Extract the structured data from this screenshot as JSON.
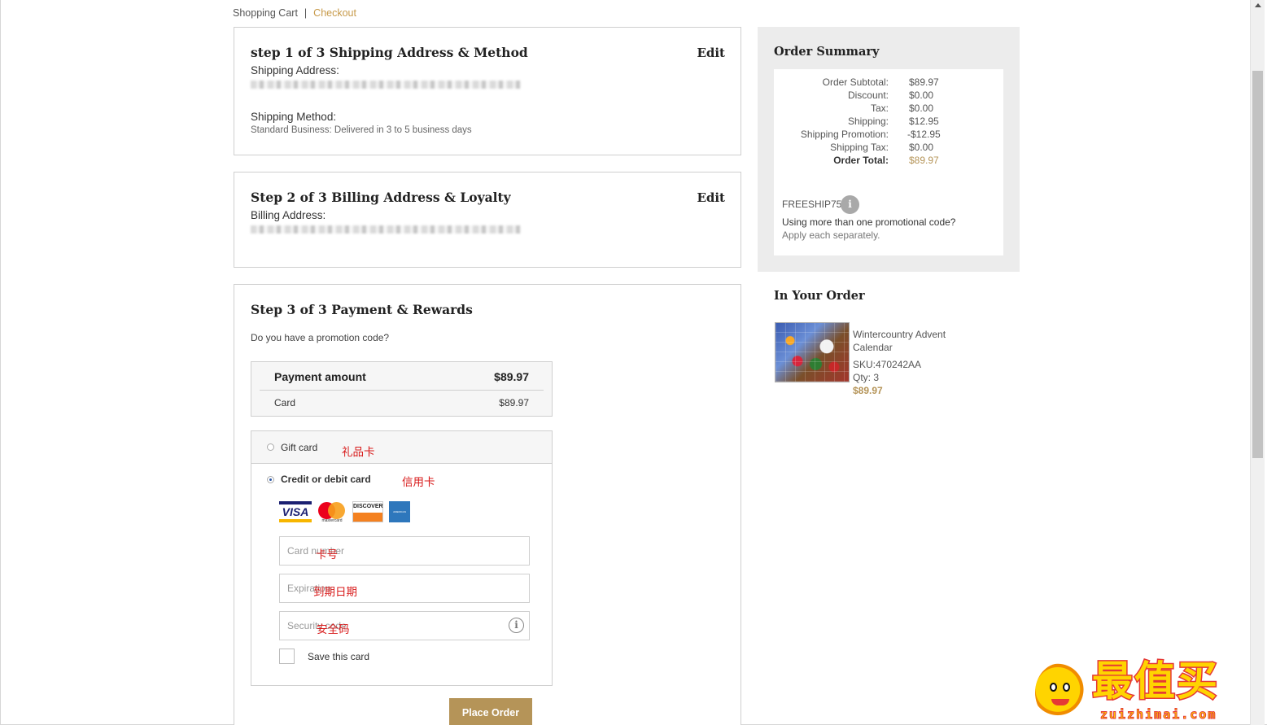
{
  "breadcrumb": {
    "cart": "Shopping Cart",
    "separator": "|",
    "checkout": "Checkout"
  },
  "step1": {
    "title": "step 1 of 3 Shipping Address & Method",
    "edit": "Edit",
    "address_label": "Shipping Address:",
    "method_label": "Shipping Method:",
    "method_value": "Standard Business: Delivered in 3 to 5 business days"
  },
  "step2": {
    "title": "Step 2 of 3 Billing Address & Loyalty",
    "edit": "Edit",
    "address_label": "Billing Address:"
  },
  "step3": {
    "title": "Step 3 of 3 Payment & Rewards",
    "promo_question": "Do you have a promotion code?",
    "payment_amount_label": "Payment amount",
    "payment_amount_value": "$89.97",
    "card_label": "Card",
    "card_value": "$89.97",
    "gift_card_label": "Gift card",
    "gift_card_note": "礼品卡",
    "credit_label": "Credit or debit card",
    "credit_note": "信用卡",
    "card_brands": [
      "VISA",
      "mastercard",
      "DISCOVER",
      "AMERICAN EXPRESS"
    ],
    "card_number_placeholder": "Card number",
    "card_number_note": "卡号",
    "expiration_placeholder": "Expiration",
    "expiration_note": "到期日期",
    "security_placeholder": "Security code",
    "security_note": "安全码",
    "save_card_label": "Save this card",
    "place_order": "Place Order",
    "selected_method": "credit"
  },
  "summary": {
    "title": "Order Summary",
    "rows": [
      {
        "label": "Order Subtotal:",
        "value": "$89.97"
      },
      {
        "label": "Discount:",
        "value": "$0.00"
      },
      {
        "label": "Tax:",
        "value": "$0.00"
      },
      {
        "label": "Shipping:",
        "value": "$12.95"
      },
      {
        "label": "Shipping Promotion:",
        "value": "-$12.95"
      },
      {
        "label": "Shipping Tax:",
        "value": "$0.00"
      },
      {
        "label": "Order Total:",
        "value": "$89.97"
      }
    ],
    "promo_code": "FREESHIP75",
    "promo_question": "Using more than one promotional code?",
    "promo_apply": "Apply each separately."
  },
  "in_order": {
    "title": "In Your Order",
    "product_name": "Wintercountry Advent Calendar",
    "sku": "SKU:470242AA",
    "qty": "Qty: 3",
    "price": "$89.97"
  },
  "watermark": {
    "title": "最值买",
    "sub": "zuizhimai.com"
  },
  "colors": {
    "accent": "#b59458",
    "link": "#c79a4a",
    "annotation": "#d81b1b"
  }
}
